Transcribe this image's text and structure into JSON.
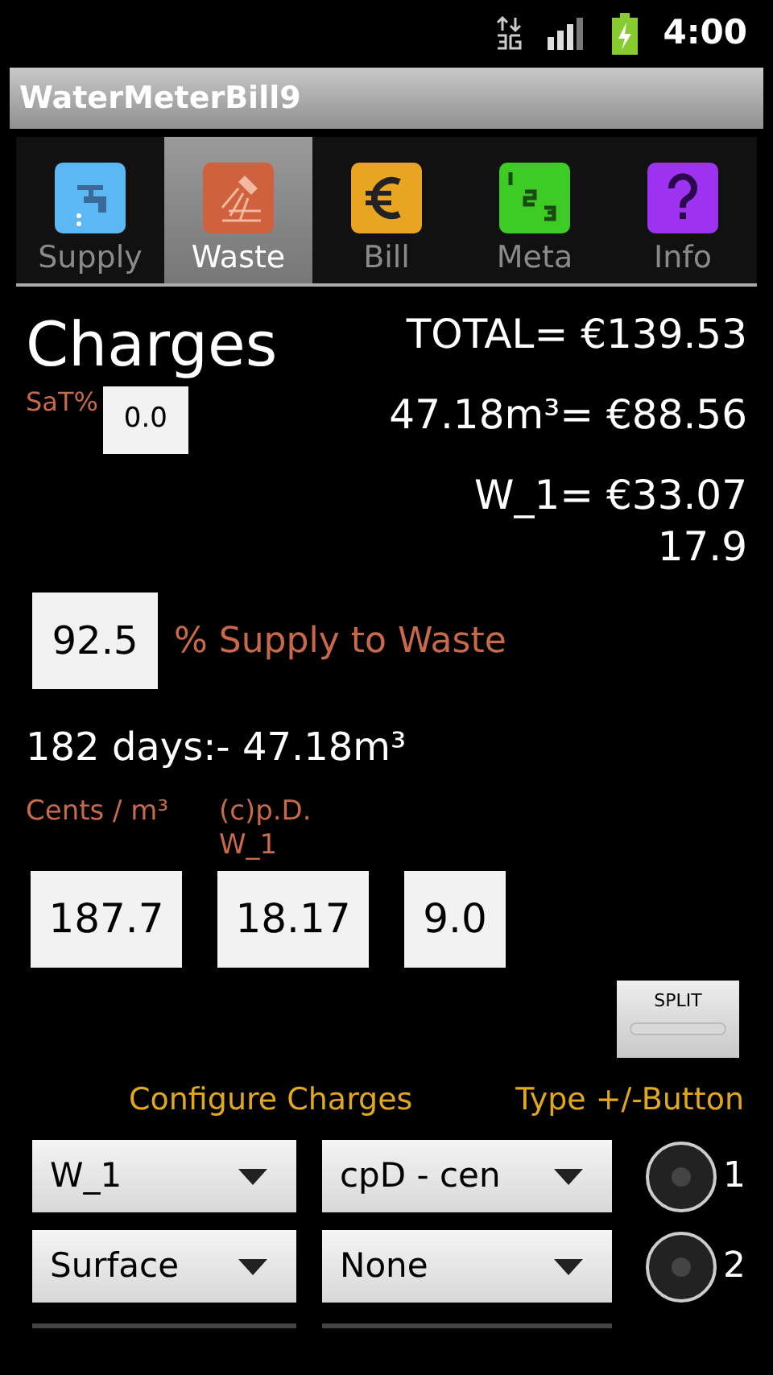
{
  "status_bar": {
    "time": "4:00"
  },
  "window": {
    "title": "WaterMeterBill9"
  },
  "tabs": [
    {
      "label": "Supply",
      "selected": false,
      "kind": "tap"
    },
    {
      "label": "Waste",
      "selected": true,
      "kind": "shower"
    },
    {
      "label": "Bill",
      "selected": false,
      "kind": "euro"
    },
    {
      "label": "Meta",
      "selected": false,
      "kind": "numbers"
    },
    {
      "label": "Info",
      "selected": false,
      "kind": "question"
    }
  ],
  "heading": "Charges",
  "sat": {
    "label": "SaT%",
    "value": "0.0"
  },
  "totals": [
    "TOTAL= €139.53",
    "47.18m³= €88.56",
    "W_1= €33.07",
    "17.9"
  ],
  "supply_to_waste": {
    "value": "92.5",
    "label": "% Supply to Waste"
  },
  "summary": "182 days:- 47.18m³",
  "rate_labels": [
    "Cents / m³",
    "(c)p.D. W_1"
  ],
  "rate_fields": [
    "187.7",
    "18.17",
    "9.0"
  ],
  "split_button": "SPLIT",
  "configure": {
    "title": "Configure Charges",
    "type_title": "Type +/-Button",
    "rows": [
      {
        "spinners": [
          "W_1",
          "cpD - cen"
        ],
        "radio": {
          "label": "1",
          "selected": false
        }
      },
      {
        "spinners": [
          "Surface",
          "None"
        ],
        "radio": {
          "label": "2",
          "selected": false
        }
      }
    ]
  }
}
